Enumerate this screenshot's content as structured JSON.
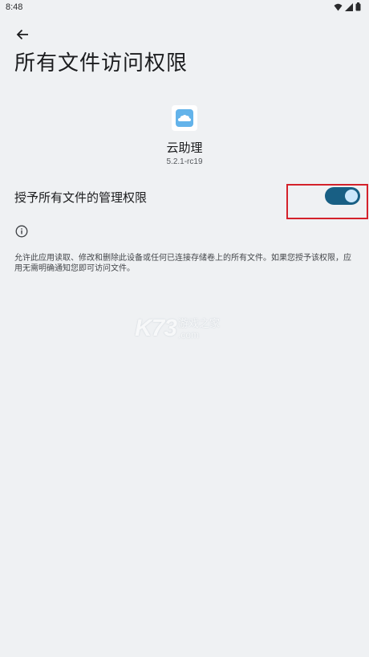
{
  "status_bar": {
    "time": "8:48",
    "icons": [
      "wifi-icon",
      "signal-icon",
      "battery-icon"
    ]
  },
  "header": {
    "back_icon": "arrow-back-icon",
    "title": "所有文件访问权限"
  },
  "app": {
    "icon": "cloud-app-icon",
    "name": "云助理",
    "version": "5.2.1-rc19"
  },
  "permission": {
    "label": "授予所有文件的管理权限",
    "enabled": true,
    "toggle_color": "#185f84",
    "highlight_color": "#d4212a"
  },
  "info": {
    "icon": "info-icon",
    "description": "允许此应用读取、修改和删除此设备或任何已连接存储卷上的所有文件。如果您授予该权限，应用无需明确通知您即可访问文件。"
  },
  "watermark": {
    "logo": "K73",
    "subtitle": "游戏之家",
    "domain": ".com"
  }
}
